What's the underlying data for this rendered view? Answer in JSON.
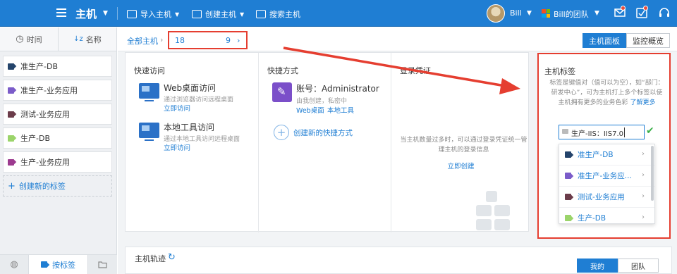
{
  "topbar": {
    "app_title": "主机",
    "import_host": "导入主机",
    "create_host": "创建主机",
    "search_host": "搜索主机",
    "user_name": "Bill",
    "team_name": "Bill的团队",
    "accent": "#1f7ed3"
  },
  "sidebar": {
    "sort_time": "时间",
    "sort_name": "名称",
    "tags": [
      {
        "label": "准生产-DB",
        "color": "#24446b"
      },
      {
        "label": "准生产-业务应用",
        "color": "#7b5cc9"
      },
      {
        "label": "测试-业务应用",
        "color": "#6b3c4a"
      },
      {
        "label": "生产-DB",
        "color": "#9bd46a"
      },
      {
        "label": "生产-业务应用",
        "color": "#9c3a8f"
      }
    ],
    "create_tag": "创建新的标签",
    "bottom_tabs": [
      "",
      "按标签",
      ""
    ]
  },
  "breadcrumb": {
    "all_hosts": "全部主机",
    "host_prefix": "18",
    "host_suffix": "9"
  },
  "view_tabs": [
    "主机面板",
    "监控概览"
  ],
  "quick_access": {
    "title": "快速访问",
    "items": [
      {
        "name": "Web桌面访问",
        "desc": "通过浏览器访问远程桌面",
        "link": "立即访问"
      },
      {
        "name": "本地工具访问",
        "desc": "通过本地工具访问远程桌面",
        "link": "立即访问"
      }
    ]
  },
  "shortcut": {
    "title": "快捷方式",
    "account": "账号：Administrator",
    "account_desc": "由我创建，私密中",
    "link_web": "Web桌面",
    "link_local": "本地工具",
    "create": "创建新的快捷方式"
  },
  "credentials": {
    "title": "登录凭证",
    "note": "当主机数量过多时，可以通过登录凭证统一管理主机的登录信息",
    "link": "立即创建"
  },
  "track": {
    "title": "主机轨迹",
    "tabs": [
      "我的",
      "团队"
    ]
  },
  "tag_panel": {
    "title": "主机标签",
    "desc": "标签是键值对（值可以为空），如“部门：研发中心”，可为主机打上多个标签以使主机拥有更多的业务色彩",
    "more": "了解更多",
    "input_value": "生产-IIS：IIS7.0",
    "dropdown": [
      {
        "label": "准生产-DB",
        "color": "#24446b"
      },
      {
        "label": "准生产-业务应...",
        "color": "#7b5cc9"
      },
      {
        "label": "测试-业务应用",
        "color": "#6b3c4a"
      },
      {
        "label": "生产-DB",
        "color": "#9bd46a"
      }
    ]
  }
}
